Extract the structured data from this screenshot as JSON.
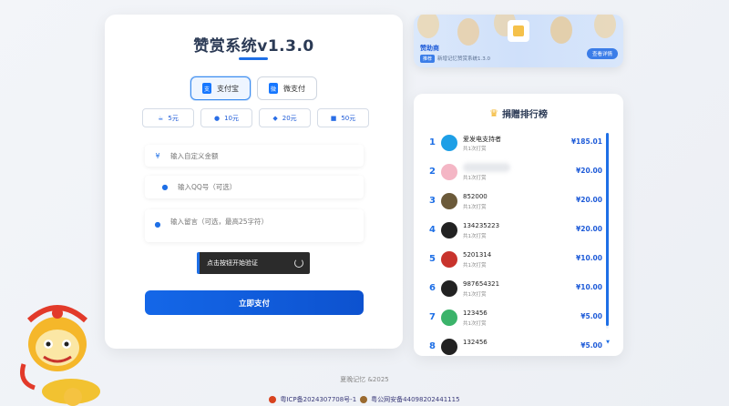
{
  "app": {
    "title": "赞赏系统v1.3.0"
  },
  "payment": {
    "methods": [
      {
        "label": "支付宝",
        "active": true,
        "icon": "alipay-icon"
      },
      {
        "label": "微支付",
        "active": false,
        "icon": "wechat-icon"
      }
    ],
    "amounts": [
      {
        "label": "5元",
        "icon": "coffee-icon"
      },
      {
        "label": "10元",
        "icon": "food-icon"
      },
      {
        "label": "20元",
        "icon": "cake-icon"
      },
      {
        "label": "50元",
        "icon": "gift-icon"
      }
    ],
    "custom_amount_placeholder": "输入自定义金额",
    "qq_placeholder": "输入QQ号（可选）",
    "message_placeholder": "输入留言（可选，最高25字符）",
    "verify_label": "点击按钮开始验证",
    "submit_label": "立即支付",
    "currency_symbol": "¥"
  },
  "sponsor": {
    "name": "赞助商",
    "tag": "推荐",
    "desc": "新增记忆赞赏系统1.3.0",
    "detail_label": "查看详情"
  },
  "ranking": {
    "title": "捐赠排行榜",
    "rows": [
      {
        "rank": "1",
        "name": "爱发电支持者",
        "count": "共1次打赏",
        "amount": "¥185.01",
        "avatar_color": "#1e9fe6"
      },
      {
        "rank": "2",
        "name": "",
        "count": "共1次打赏",
        "amount": "¥20.00",
        "avatar_color": "#f4b6c5"
      },
      {
        "rank": "3",
        "name": "852000",
        "count": "共1次打赏",
        "amount": "¥20.00",
        "avatar_color": "#6b5a3a"
      },
      {
        "rank": "4",
        "name": "134235223",
        "count": "共1次打赏",
        "amount": "¥20.00",
        "avatar_color": "#222222"
      },
      {
        "rank": "5",
        "name": "5201314",
        "count": "共1次打赏",
        "amount": "¥10.00",
        "avatar_color": "#c8332c"
      },
      {
        "rank": "6",
        "name": "987654321",
        "count": "共1次打赏",
        "amount": "¥10.00",
        "avatar_color": "#222222"
      },
      {
        "rank": "7",
        "name": "123456",
        "count": "共1次打赏",
        "amount": "¥5.00",
        "avatar_color": "#3bb36a"
      },
      {
        "rank": "8",
        "name": "132456",
        "count": "",
        "amount": "¥5.00",
        "avatar_color": "#222222"
      }
    ]
  },
  "footer": {
    "copyright": "夏晚记忆 &2025",
    "icp": "粤ICP备2024307708号-1",
    "police": "粤公网安备44098202441115"
  },
  "colors": {
    "accent": "#1e6fe6",
    "submit": "#1467e8"
  }
}
